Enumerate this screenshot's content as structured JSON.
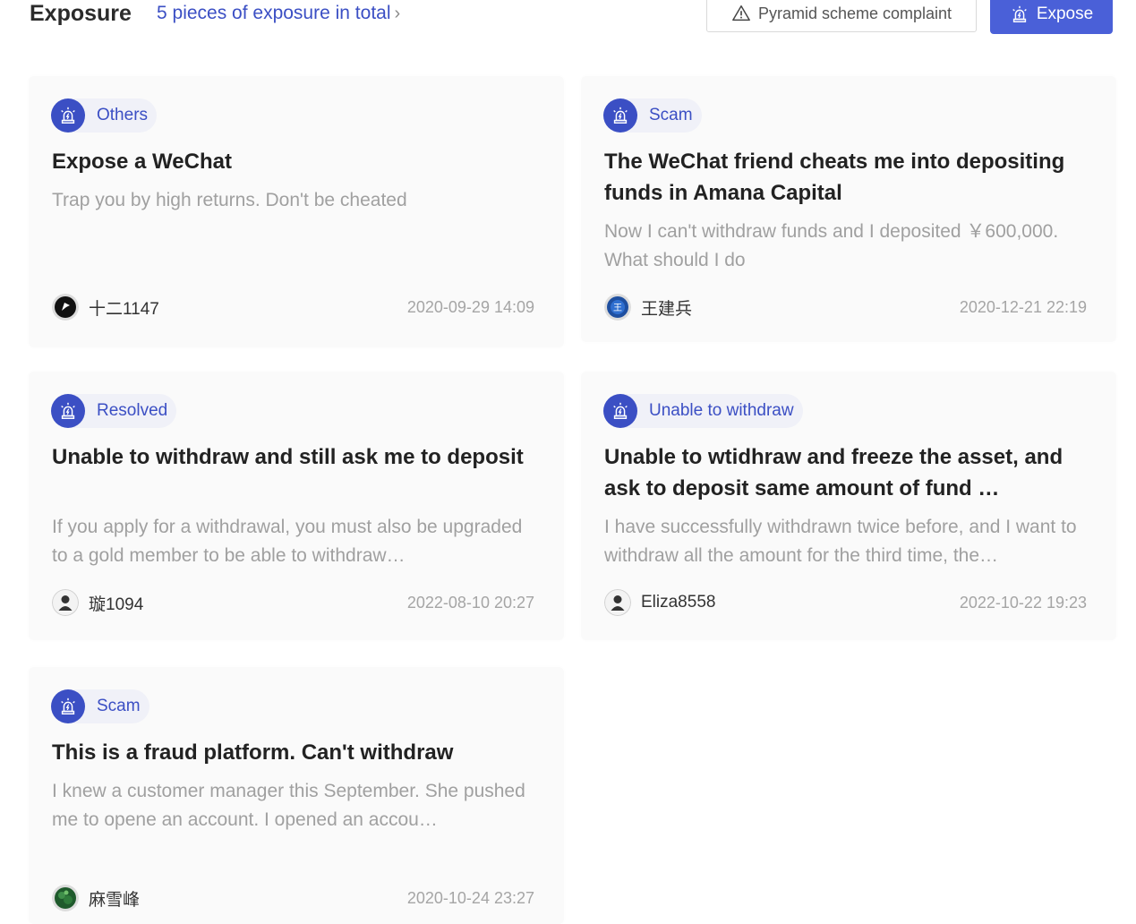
{
  "header": {
    "title": "Exposure",
    "count_text": "5 pieces of exposure in total",
    "complaint_button": "Pyramid scheme complaint",
    "expose_button": "Expose"
  },
  "colors": {
    "accent": "#3b4fc4",
    "button_primary": "#4a60d8",
    "card_bg": "#fafafa",
    "muted_text": "#a0a0a0"
  },
  "cards": [
    {
      "tag": "Others",
      "title": "Expose a WeChat",
      "desc": "Trap you by high returns. Don't be cheated",
      "author": "十二1147",
      "date": "2020-09-29 14:09",
      "avatar": "black-flag-avatar"
    },
    {
      "tag": "Scam",
      "title": "The WeChat friend cheats me into depositing funds in Amana Capital",
      "desc": "Now I can't withdraw funds and I deposited ￥600,000. What should I do",
      "author": "王建兵",
      "date": "2020-12-21 22:19",
      "avatar": "blue-seal-avatar"
    },
    {
      "tag": "Resolved",
      "title": "Unable to withdraw and still ask me to deposit",
      "desc": "If you apply for a withdrawal, you must also be upgraded to a gold member to be able to withdraw…",
      "author": "璇1094",
      "date": "2022-08-10 20:27",
      "avatar": "default-user-avatar"
    },
    {
      "tag": "Unable to withdraw",
      "title": "Unable to wtidhraw and freeze the asset, and ask to deposit same amount of fund …",
      "desc": "I have successfully withdrawn twice before, and I want to withdraw all the amount for the third time, the…",
      "author": "Eliza8558",
      "date": "2022-10-22 19:23",
      "avatar": "default-user-avatar"
    },
    {
      "tag": "Scam",
      "title": "This is a fraud platform. Can't withdraw",
      "desc": "I knew a customer manager this September. She pushed me to opene an account. I opened an accou…",
      "author": "麻雪峰",
      "date": "2020-10-24 23:27",
      "avatar": "green-leaf-avatar"
    }
  ]
}
